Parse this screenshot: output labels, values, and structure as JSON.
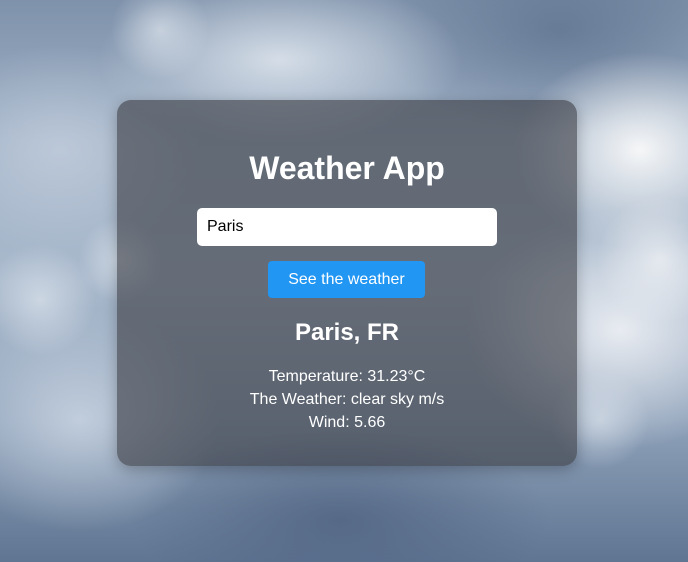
{
  "app": {
    "title": "Weather App"
  },
  "search": {
    "value": "Paris",
    "button_label": "See the weather"
  },
  "result": {
    "location": "Paris, FR",
    "temperature": "Temperature: 31.23°C",
    "weather": "The Weather: clear sky m/s",
    "wind": "Wind: 5.66"
  },
  "colors": {
    "button": "#2196f3",
    "card": "rgba(60,62,68,0.62)",
    "text": "#ffffff"
  }
}
